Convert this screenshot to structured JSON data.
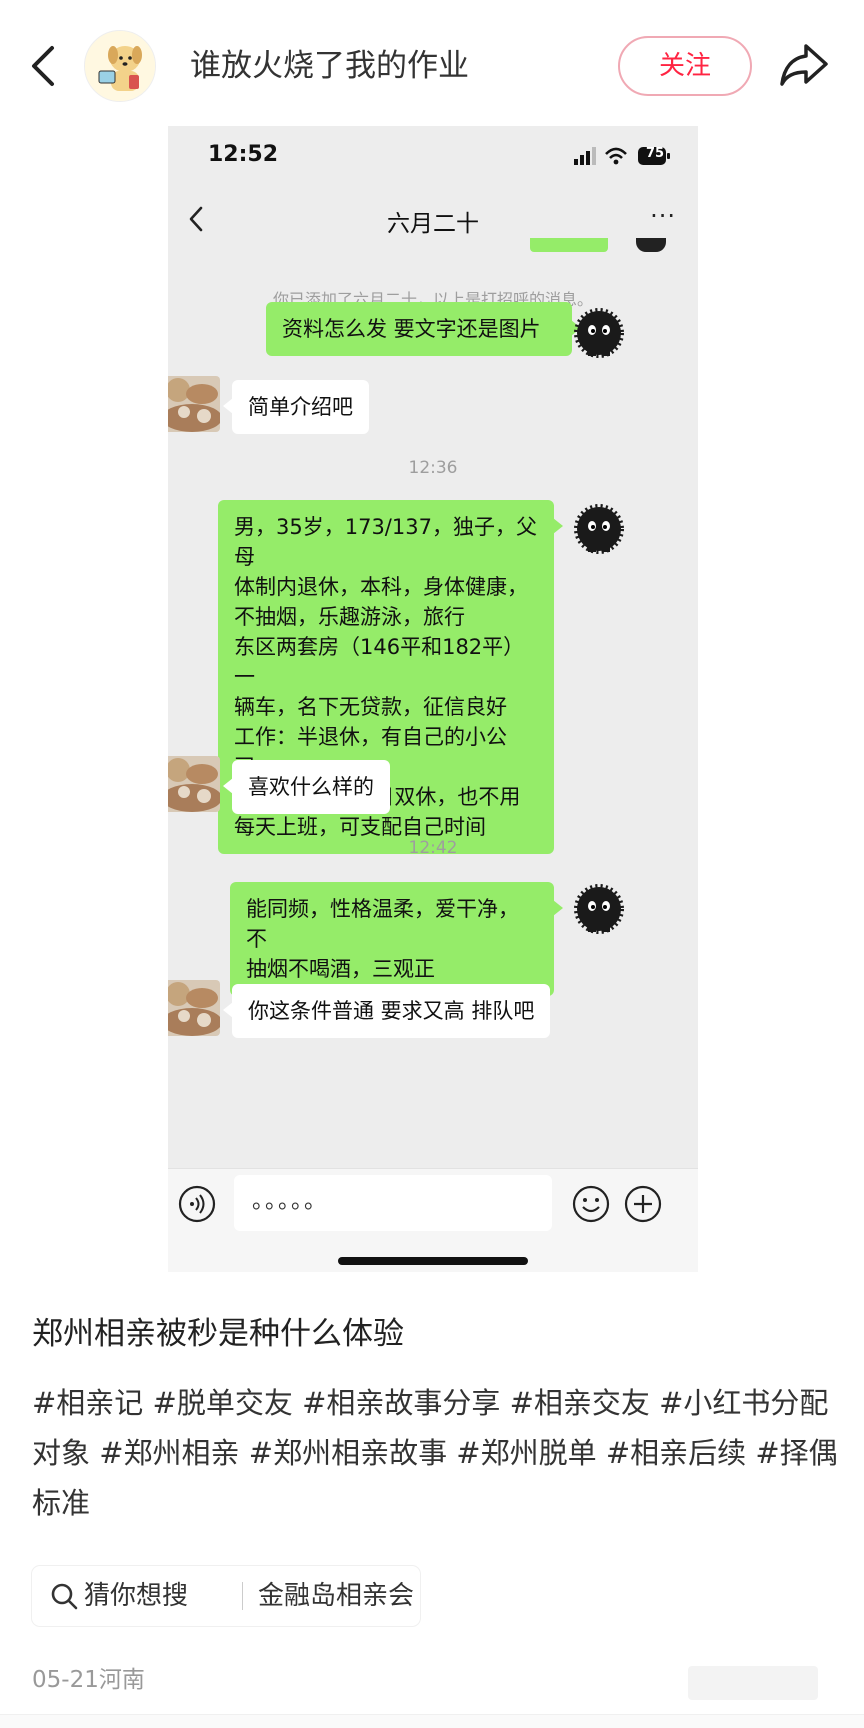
{
  "header": {
    "author_name": "谁放火烧了我的作业",
    "follow_label": "关注"
  },
  "screenshot": {
    "status": {
      "time": "12:52",
      "battery": "75"
    },
    "chat": {
      "title": "六月二十",
      "more": "···",
      "system_note": "你已添加了六月二十，以上是打招呼的消息。",
      "time_separators": [
        "12:36",
        "12:42"
      ],
      "messages": [
        {
          "side": "me",
          "text": "资料怎么发 要文字还是图片"
        },
        {
          "side": "them",
          "text": "简单介绍吧"
        },
        {
          "side": "me",
          "lines": [
            "男，35岁，173/137，独子，父母",
            "体制内退休，本科，身体健康，",
            "不抽烟，乐趣游泳，旅行",
            "东区两套房（146平和182平）一",
            "辆车，名下无贷款，征信良好",
            "工作：半退休，有自己的小公司，",
            "4个同事，周六日双休，也不用",
            "每天上班，可支配自己时间"
          ]
        },
        {
          "side": "them",
          "text": "喜欢什么样的"
        },
        {
          "side": "me",
          "lines": [
            "能同频，性格温柔，爱干净，不",
            "抽烟不喝酒，三观正"
          ]
        },
        {
          "side": "them",
          "text": "你这条件普通 要求又高 排队吧"
        }
      ],
      "input_value": "。。。。。"
    }
  },
  "post": {
    "title": "郑州相亲被秒是种什么体验",
    "tags": [
      "#相亲记",
      "#脱单交友",
      "#相亲故事分享",
      "#相亲交友",
      "#小红书分配对象",
      "#郑州相亲",
      "#郑州相亲故事",
      "#郑州脱单",
      "#相亲后续",
      "#择偶标准"
    ],
    "search": {
      "label": "猜你想搜",
      "query": "金融岛相亲会"
    },
    "meta": "05-21河南"
  },
  "colors": {
    "accent": "#ff2442",
    "bubble_me": "#95ec69",
    "chat_bg": "#ededed"
  }
}
